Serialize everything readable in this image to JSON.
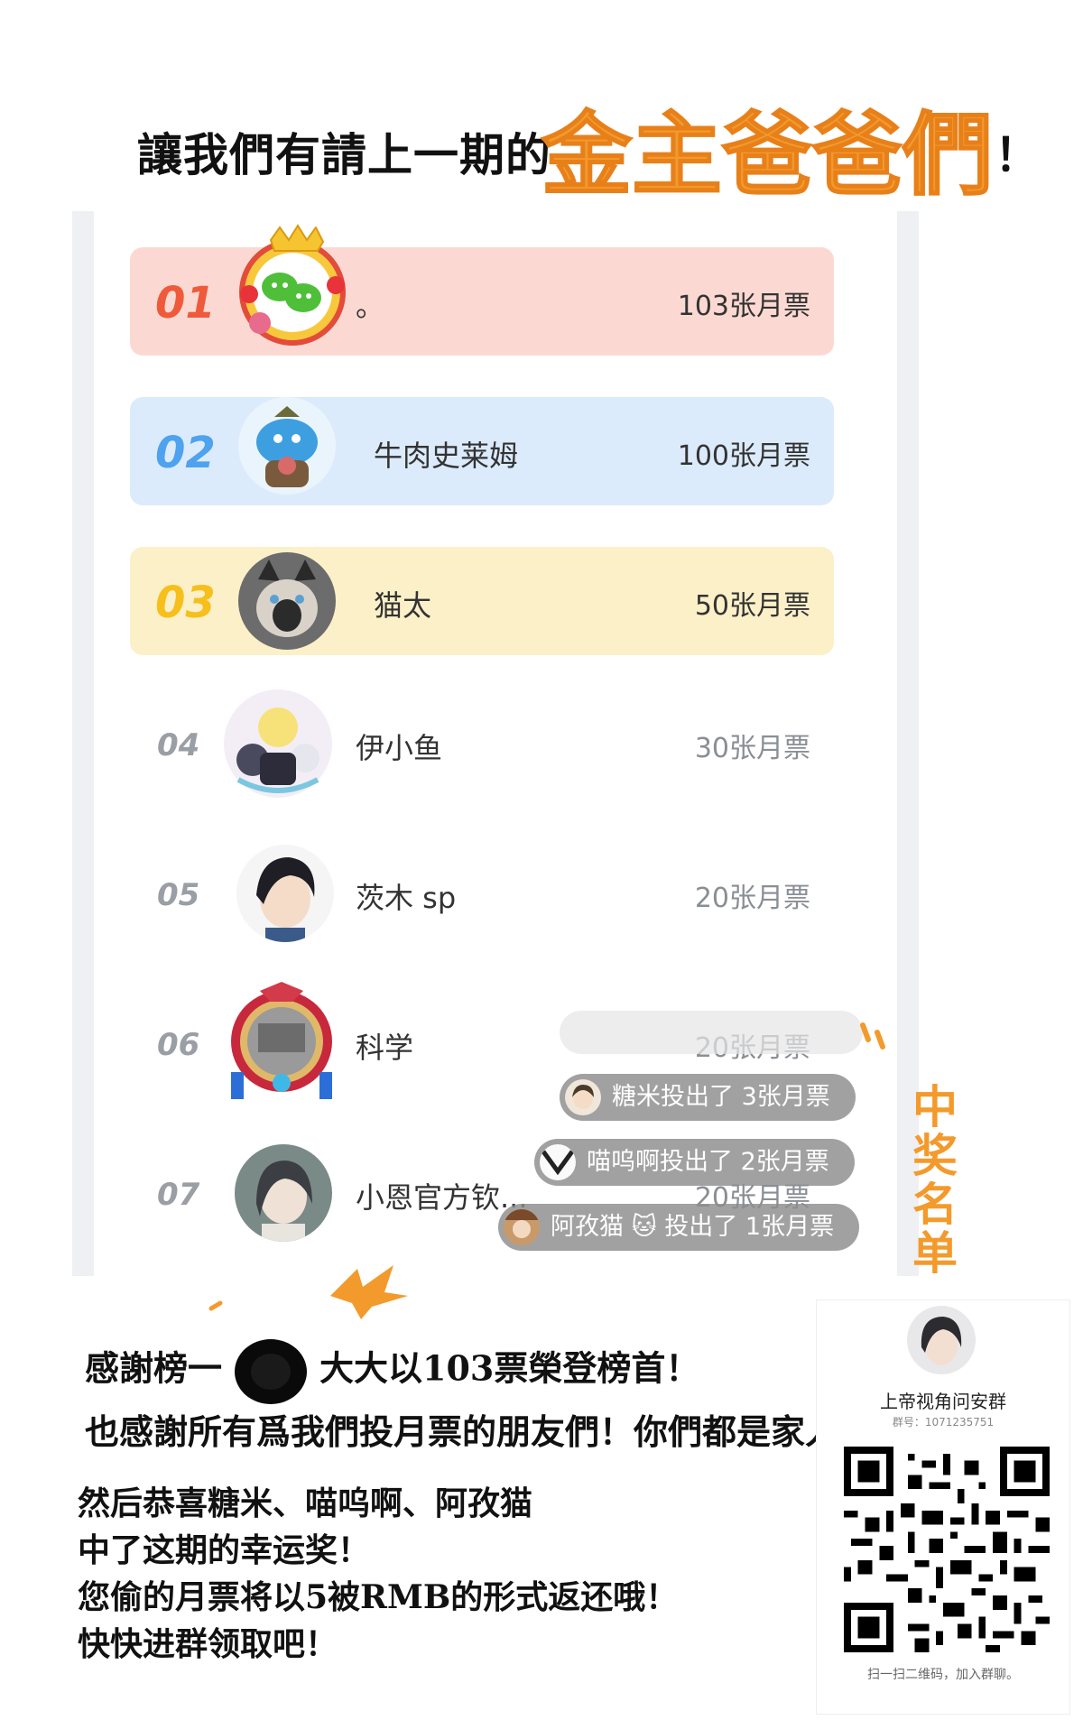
{
  "header": {
    "lead": "讓我們有請上一期的",
    "highlight": "金主爸爸們",
    "bang": "！"
  },
  "colors": {
    "accent_orange": "#f39a2c",
    "rank1_bg": "#fbd9d2",
    "rank2_bg": "#dcebfb",
    "rank3_bg": "#fcf0c9"
  },
  "ranking": [
    {
      "rank": "01",
      "name": "。",
      "votes": "103张月票",
      "avatar": "wechat-crown-avatar"
    },
    {
      "rank": "02",
      "name": "牛肉史莱姆",
      "votes": "100张月票",
      "avatar": "slime-avatar"
    },
    {
      "rank": "03",
      "name": "猫太",
      "votes": "50张月票",
      "avatar": "cat-avatar"
    },
    {
      "rank": "04",
      "name": "伊小鱼",
      "votes": "30张月票",
      "avatar": "anime-group-avatar"
    },
    {
      "rank": "05",
      "name": "茨木 sp",
      "votes": "20张月票",
      "avatar": "dark-hair-avatar"
    },
    {
      "rank": "06",
      "name": "科学",
      "votes": "20张月票",
      "avatar": "ornate-frame-avatar"
    },
    {
      "rank": "07",
      "name": "小恩官方钦...",
      "votes": "20张月票",
      "avatar": "anime-girl-avatar"
    }
  ],
  "toasts": [
    {
      "text": "糖米投出了 3张月票"
    },
    {
      "text": "喵呜啊投出了 2张月票"
    },
    {
      "text": "阿孜猫 🐱 投出了 1张月票"
    }
  ],
  "side_label": [
    "中",
    "奖",
    "名",
    "单"
  ],
  "thanks": {
    "line1_pre": "感謝榜一",
    "line1_post": "大大以103票榮登榜首！",
    "line2": "也感謝所有爲我們投月票的朋友們！你們都是家人！"
  },
  "winners": {
    "line1": "然后恭喜糖米、喵呜啊、阿孜猫",
    "line2": "中了这期的幸运奖！",
    "line3": "您偷的月票将以5被RMB的形式返还哦！",
    "line4": "快快进群领取吧！"
  },
  "qr": {
    "title": "上帝视角问安群",
    "group_id": "群号：1071235751",
    "caption": "扫一扫二维码，加入群聊。"
  }
}
